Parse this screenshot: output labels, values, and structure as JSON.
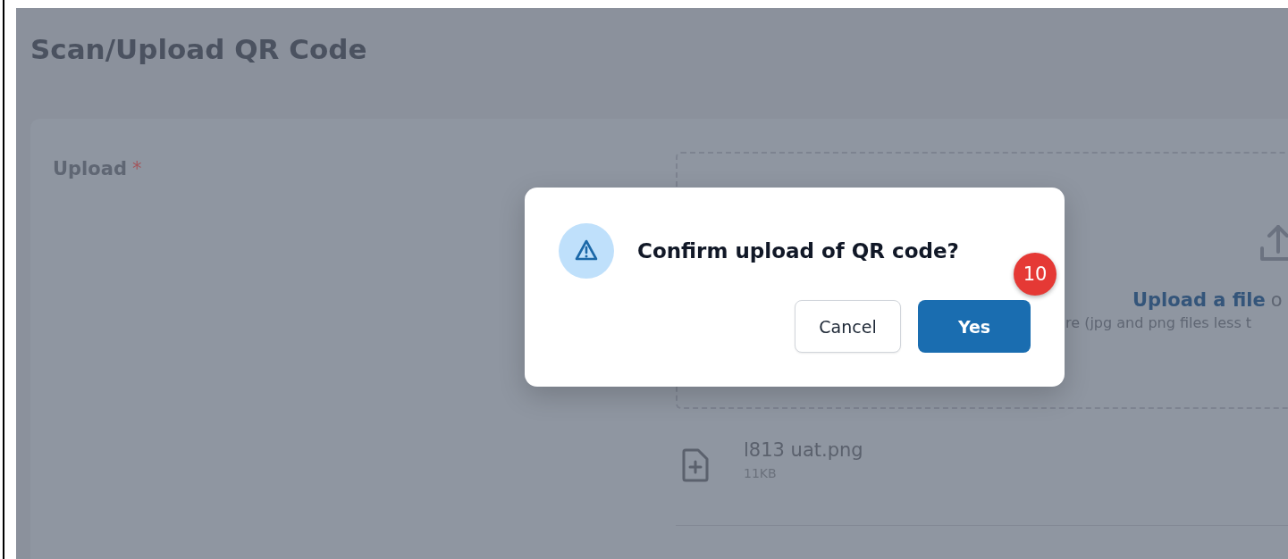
{
  "page": {
    "title": "Scan/Upload QR Code"
  },
  "upload": {
    "label": "Upload",
    "required_mark": "*"
  },
  "dropzone": {
    "link": "Upload a file",
    "link_tail": "o",
    "hint": "re (jpg and png files less t"
  },
  "files": [
    {
      "name": "l813 uat.png",
      "size": "11KB"
    }
  ],
  "dialog": {
    "message": "Confirm upload of QR code?",
    "buttons": [
      {
        "label": "Cancel",
        "kind": "secondary"
      },
      {
        "label": "Yes",
        "kind": "primary"
      }
    ]
  },
  "badge": {
    "label": "10"
  }
}
